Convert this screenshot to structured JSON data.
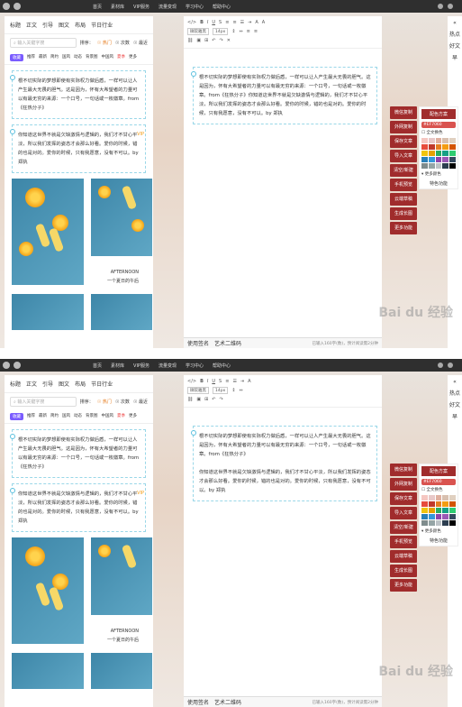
{
  "topbar": {
    "nav": [
      "首页",
      "素材库",
      "VIP服务",
      "流量变现",
      "学习中心",
      "帮助中心"
    ]
  },
  "sidebar": {
    "tabs": [
      "标题",
      "正文",
      "引导",
      "图文",
      "布局",
      "节日行业"
    ],
    "search_placeholder": "输入关键字搜",
    "sort_label": "排序：",
    "sort_options": [
      "☉ 热门",
      "☉ 次数",
      "☉ 最近"
    ],
    "subtabs": [
      "收藏",
      "推荐",
      "最新",
      "简约",
      "国风",
      "动态",
      "背景图",
      "中国风",
      "夏季",
      "更多"
    ],
    "cards": [
      {
        "text": "根不切实际的梦想即使有实际权力做后盾，一样可以让人产生最大无畏的胆气。这是因为，怀有大希望者的力量可以有最无穷的来源：一个口号，一句话或一枚徽章。from《狂热分子》"
      },
      {
        "text": "你知道这世界不就是欠缺激情与逻辑的，我们才不甘心平淡，所以我们发挥的姿态才会那么好看。爱你的时候，错的也是对的。爱你的时候，只有我愿意，没有不可以。by 郑执"
      }
    ],
    "vip_label": "VIP",
    "caption": {
      "line1": "AFTERNOON",
      "line2": "一个夏日的午后"
    }
  },
  "editor": {
    "toolbar": {
      "font": "微软雅黑",
      "size": "14px"
    },
    "cards_p1": [
      {
        "text": "根不切实际的梦想即使有实际权力做后盾，一样可以让人产生最大无畏的胆气。这是因为，怀有大希望者的力量可以有最无穷的来源：一个口号，一句话或一枚徽章。from《狂热分子》你知道这世界不就是欠缺激情与逻辑的，我们才不甘心平淡，所以我们发挥的姿态才会那么好看。爱你的时候，错的也是对的。爱你的时候，只有我愿意，没有不可以。by 郑执"
      }
    ],
    "cards_p2": [
      {
        "text": "根不切实际的梦想即使有实际权力做后盾，一样可以让人产生最大无畏的胆气。这是因为，怀有大希望者的力量可以有最无穷的来源：一个口号，一句话或一枚徽章。from《狂热分子》"
      },
      {
        "text": "你知道这世界不就是欠缺激情与逻辑的，我们才不甘心平淡，所以我们发挥的姿态才会那么好看。爱你的时候，错的也是对的。爱你的时候，只有我愿意，没有不可以。by 郑执"
      }
    ],
    "bottom_tabs": [
      "使用签名",
      "艺术二维码"
    ],
    "word_count": "已输入160字(数)，预计阅读需2分钟"
  },
  "right": {
    "side": [
      "热点",
      "好文",
      "早"
    ],
    "quick": [
      "微信复制",
      "外网复制",
      "保存文章",
      "导入文章",
      "清空/新建",
      "手机预览",
      "云端草稿",
      "生成长图",
      "更多功能"
    ],
    "scheme_title": "配色方案",
    "scheme_color": "#EF7060",
    "full_color": "全文换色",
    "more_colors": "更多颜色",
    "feature": "特色功能",
    "palette": [
      "#f5c6c1",
      "#e8c8c8",
      "#e0b0a0",
      "#d8c0b0",
      "#e0d0c0",
      "#e74c3c",
      "#c0392b",
      "#e67e22",
      "#f39c12",
      "#d35400",
      "#f1c40f",
      "#e5a100",
      "#27ae60",
      "#16a085",
      "#2ecc71",
      "#2980b9",
      "#3498db",
      "#8e44ad",
      "#9b59b6",
      "#34495e",
      "#7f8c8d",
      "#95a5a6",
      "#bdc3c7",
      "#2c3e50",
      "#000000"
    ]
  },
  "watermark": "Bai du 经验"
}
